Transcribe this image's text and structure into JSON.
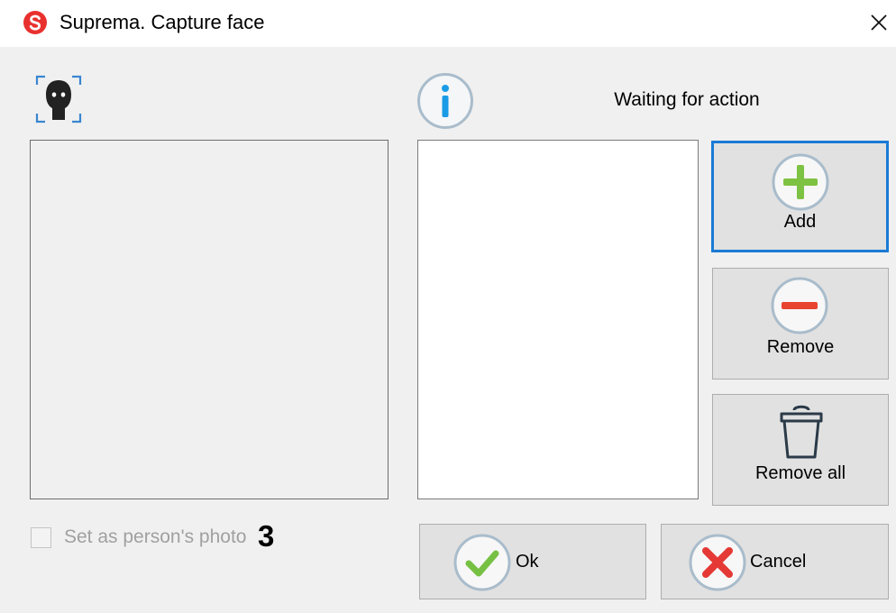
{
  "window": {
    "title": "Suprema. Capture face",
    "app_icon": "suprema-logo-icon",
    "close_icon": "close-icon"
  },
  "status": {
    "icon": "info-icon",
    "text": "Waiting for action"
  },
  "buttons": {
    "add": {
      "label": "Add",
      "icon": "plus-circle-icon"
    },
    "remove": {
      "label": "Remove",
      "icon": "minus-circle-icon"
    },
    "remove_all": {
      "label": "Remove all",
      "icon": "trash-icon"
    },
    "ok": {
      "label": "Ok",
      "icon": "checkmark-circle-icon"
    },
    "cancel": {
      "label": "Cancel",
      "icon": "x-circle-icon"
    }
  },
  "checkbox": {
    "label": "Set as person's photo",
    "checked": false,
    "enabled": false
  },
  "annotation": {
    "step": "3"
  },
  "face_icon": "face-capture-icon",
  "colors": {
    "suprema_red": "#e8312f",
    "focus_blue": "#1a7bd6",
    "info_blue": "#1a9be6",
    "add_green": "#7dc242",
    "remove_red": "#e8432f",
    "ok_green": "#76c043",
    "cancel_red": "#e53935",
    "dialog_bg": "#f0f0f0"
  }
}
